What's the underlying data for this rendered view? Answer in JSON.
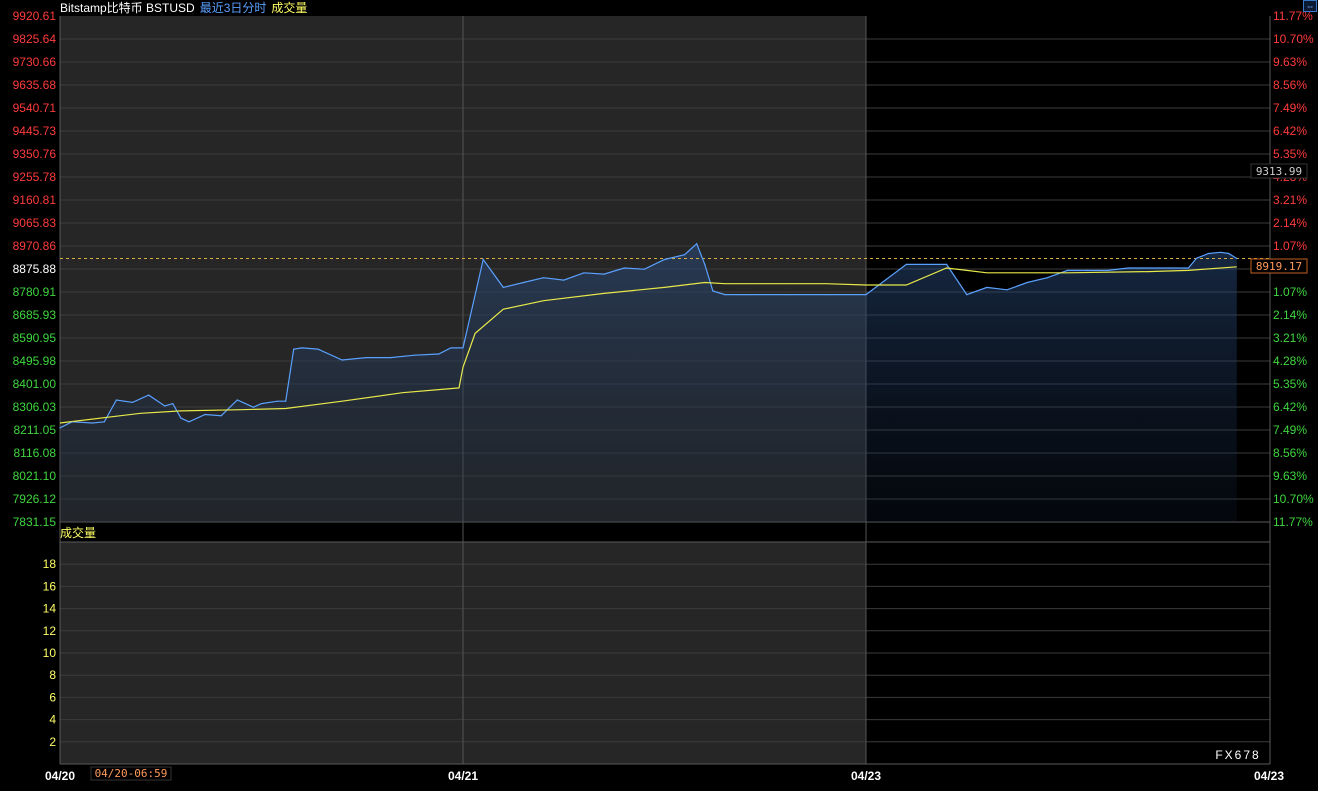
{
  "header": {
    "symbol": "Bitstamp比特币 BSTUSD",
    "mode": "最近3日分时",
    "indicator": "成交量"
  },
  "volume_panel": {
    "title": "成交量"
  },
  "watermark": "FX678",
  "cursor_time": "04/20-06:59",
  "price_tags": {
    "top_price": "9313.99",
    "last_price": "8919.17"
  },
  "colors": {
    "price_line": "#5aa0ff",
    "avg_line": "#e8e84a",
    "up": "#ff3b3b",
    "down": "#3fd63f",
    "grid": "#3c3c3c",
    "dashed_ref": "#d8b040",
    "panel_bg_active": "#262626",
    "panel_bg_future": "#000000"
  },
  "chart_data": [
    {
      "type": "line",
      "title": "Bitstamp比特币 BSTUSD 最近3日分时",
      "reference_price": 8919.17,
      "y_ticks_left": [
        "9920.61",
        "9825.64",
        "9730.66",
        "9635.68",
        "9540.71",
        "9445.73",
        "9350.76",
        "9255.78",
        "9160.81",
        "9065.83",
        "8970.86",
        "8875.88",
        "8780.91",
        "8685.93",
        "8590.95",
        "8495.98",
        "8401.00",
        "8306.03",
        "8211.05",
        "8116.08",
        "8021.10",
        "7926.12",
        "7831.15"
      ],
      "y_ticks_right": [
        "11.77%",
        "10.70%",
        "9.63%",
        "8.56%",
        "7.49%",
        "6.42%",
        "5.35%",
        "4.28%",
        "3.21%",
        "2.14%",
        "1.07%",
        "",
        "1.07%",
        "2.14%",
        "3.21%",
        "4.28%",
        "5.35%",
        "6.42%",
        "7.49%",
        "8.56%",
        "9.63%",
        "10.70%",
        "11.77%"
      ],
      "ylim": [
        7831.15,
        9920.61
      ],
      "x_ticks": [
        "04/20",
        "04/21",
        "04/23",
        "04/23"
      ],
      "xlim": [
        0,
        3
      ],
      "series": [
        {
          "name": "分时价格",
          "x": [
            0,
            0.03,
            0.08,
            0.11,
            0.14,
            0.18,
            0.22,
            0.26,
            0.28,
            0.3,
            0.32,
            0.36,
            0.4,
            0.44,
            0.48,
            0.5,
            0.54,
            0.56,
            0.58,
            0.6,
            0.64,
            0.7,
            0.76,
            0.82,
            0.88,
            0.94,
            0.97,
            1.0,
            1.05,
            1.1,
            1.15,
            1.2,
            1.25,
            1.3,
            1.35,
            1.4,
            1.45,
            1.5,
            1.55,
            1.58,
            1.6,
            1.62,
            1.65,
            1.68,
            1.7,
            1.8,
            1.9,
            2.0,
            2.1,
            2.2,
            2.25,
            2.3,
            2.35,
            2.4,
            2.45,
            2.5,
            2.55,
            2.6,
            2.65,
            2.7,
            2.75,
            2.8,
            2.82,
            2.85,
            2.88,
            2.9,
            2.92
          ],
          "y": [
            8220,
            8245,
            8240,
            8245,
            8335,
            8325,
            8355,
            8310,
            8320,
            8260,
            8245,
            8275,
            8270,
            8335,
            8305,
            8320,
            8330,
            8330,
            8545,
            8550,
            8545,
            8500,
            8510,
            8510,
            8520,
            8525,
            8550,
            8550,
            8915,
            8800,
            8820,
            8840,
            8830,
            8860,
            8855,
            8880,
            8875,
            8915,
            8935,
            8980,
            8895,
            8785,
            8770,
            8770,
            8770,
            8770,
            8770,
            8770,
            8895,
            8895,
            8770,
            8800,
            8790,
            8820,
            8840,
            8870,
            8870,
            8870,
            8880,
            8880,
            8880,
            8880,
            8920,
            8940,
            8945,
            8940,
            8919.17
          ]
        },
        {
          "name": "均价",
          "x": [
            0,
            0.2,
            0.3,
            0.45,
            0.56,
            0.7,
            0.85,
            0.99,
            1.0,
            1.03,
            1.1,
            1.2,
            1.35,
            1.5,
            1.6,
            1.65,
            1.9,
            2.0,
            2.1,
            2.2,
            2.25,
            2.3,
            2.5,
            2.7,
            2.8,
            2.92
          ],
          "y": [
            8240,
            8280,
            8290,
            8295,
            8300,
            8330,
            8365,
            8385,
            8470,
            8610,
            8710,
            8745,
            8775,
            8800,
            8820,
            8815,
            8815,
            8810,
            8810,
            8880,
            8870,
            8860,
            8860,
            8865,
            8870,
            8885
          ]
        }
      ]
    },
    {
      "type": "bar",
      "title": "成交量",
      "y_ticks_left": [
        "18",
        "16",
        "14",
        "12",
        "10",
        "8",
        "6",
        "4",
        "2"
      ],
      "ylim": [
        0,
        20
      ],
      "categories": [],
      "values": []
    }
  ]
}
